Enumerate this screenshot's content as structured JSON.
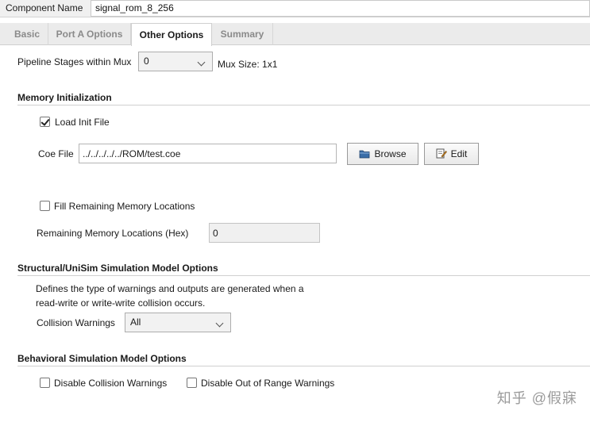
{
  "component": {
    "label": "Component Name",
    "value": "signal_rom_8_256"
  },
  "tabs": [
    {
      "label": "Basic",
      "active": false
    },
    {
      "label": "Port A Options",
      "active": false
    },
    {
      "label": "Other Options",
      "active": true
    },
    {
      "label": "Summary",
      "active": false
    }
  ],
  "pipeline": {
    "label": "Pipeline Stages within Mux",
    "value": "0",
    "mux_size": "Mux Size: 1x1"
  },
  "memory_init": {
    "title": "Memory Initialization",
    "load_init_label": "Load Init File",
    "load_init_checked": true,
    "coe_label": "Coe File",
    "coe_value": "../../../../../ROM/test.coe",
    "browse_label": "Browse",
    "edit_label": "Edit",
    "fill_label": "Fill Remaining Memory Locations",
    "fill_checked": false,
    "remaining_label": "Remaining Memory Locations (Hex)",
    "remaining_value": "0"
  },
  "structural": {
    "title": "Structural/UniSim Simulation Model Options",
    "desc_line1": "Defines the type of warnings and outputs are generated when a",
    "desc_line2": "read-write or write-write collision occurs.",
    "collision_label": "Collision Warnings",
    "collision_value": "All"
  },
  "behavioral": {
    "title": "Behavioral Simulation Model Options",
    "disable_collision_label": "Disable Collision Warnings",
    "disable_collision_checked": false,
    "disable_range_label": "Disable Out of Range Warnings",
    "disable_range_checked": false
  },
  "watermark": "知乎 @假寐",
  "icons": {
    "browse": "folder-icon",
    "edit": "edit-document-icon"
  }
}
